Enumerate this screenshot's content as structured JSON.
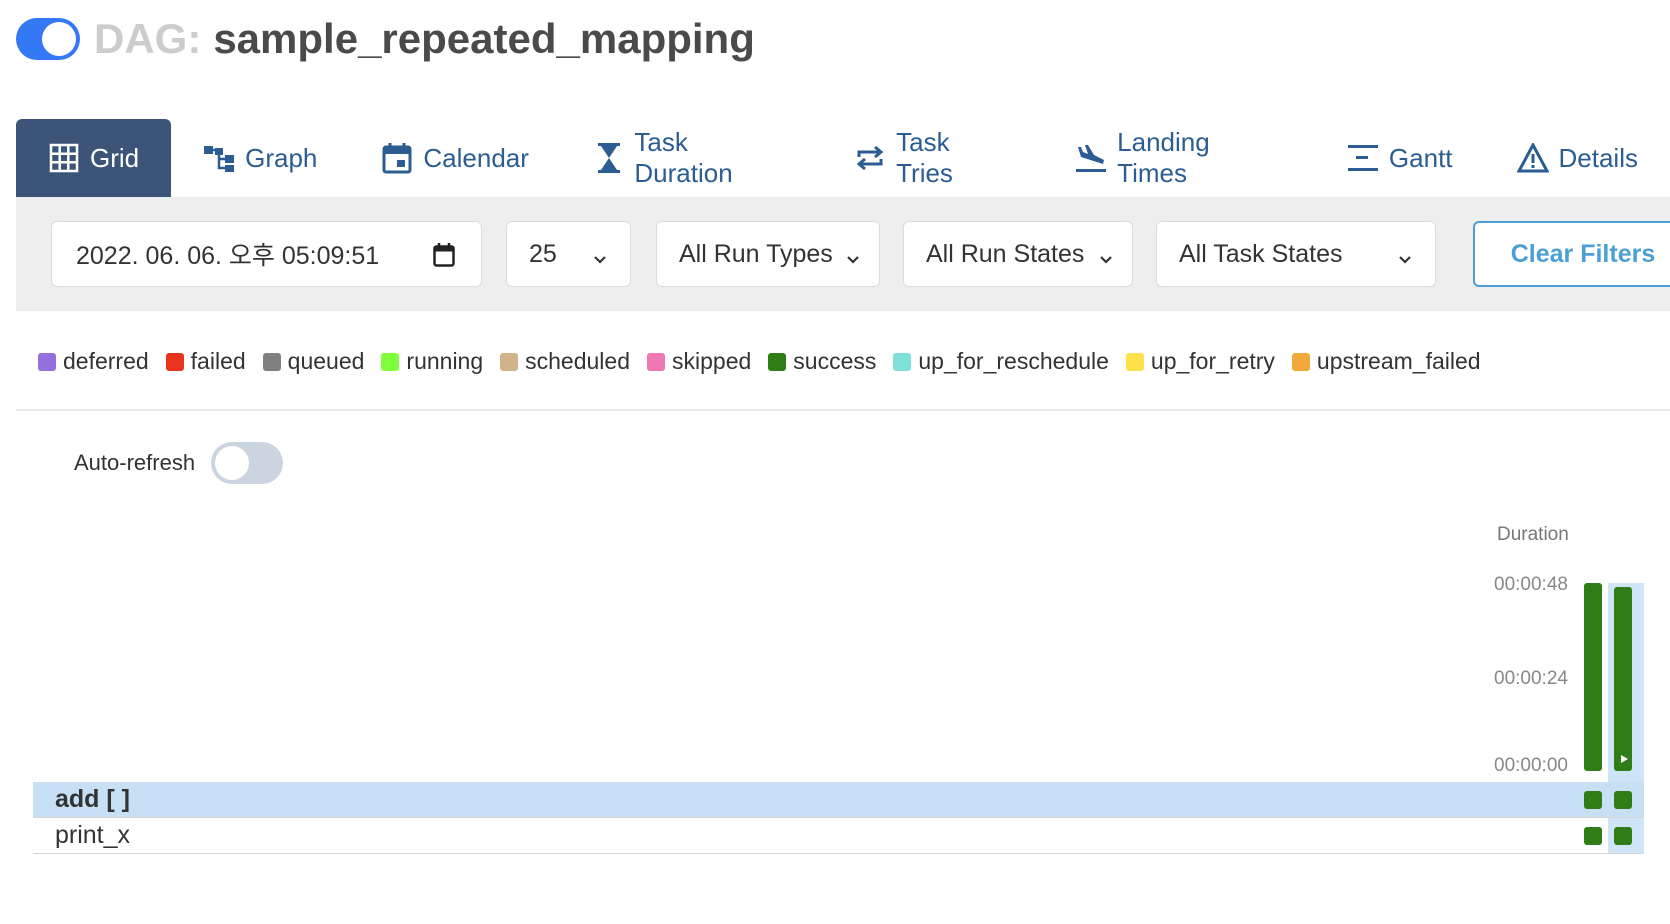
{
  "header": {
    "dag_prefix": "DAG:",
    "dag_name": "sample_repeated_mapping",
    "paused_toggle_on": true
  },
  "tabs": [
    {
      "label": "Grid",
      "icon": "grid-icon",
      "active": true
    },
    {
      "label": "Graph",
      "icon": "graph-icon"
    },
    {
      "label": "Calendar",
      "icon": "calendar-icon"
    },
    {
      "label": "Task Duration",
      "icon": "hourglass-icon"
    },
    {
      "label": "Task Tries",
      "icon": "repeat-icon"
    },
    {
      "label": "Landing Times",
      "icon": "plane-landing-icon"
    },
    {
      "label": "Gantt",
      "icon": "gantt-icon"
    },
    {
      "label": "Details",
      "icon": "warning-triangle-icon"
    }
  ],
  "filters": {
    "base_date": "2022. 06. 06. 오후 05:09:51",
    "num_runs": "25",
    "run_types": "All Run Types",
    "run_states": "All Run States",
    "task_states": "All Task States",
    "clear_label": "Clear Filters"
  },
  "legend": [
    {
      "label": "deferred",
      "color": "#9370db"
    },
    {
      "label": "failed",
      "color": "#e8331d"
    },
    {
      "label": "queued",
      "color": "#808080"
    },
    {
      "label": "running",
      "color": "#7fff3a"
    },
    {
      "label": "scheduled",
      "color": "#d2b48c"
    },
    {
      "label": "skipped",
      "color": "#ef77b4"
    },
    {
      "label": "success",
      "color": "#2f7d17"
    },
    {
      "label": "up_for_reschedule",
      "color": "#7ee0d8"
    },
    {
      "label": "up_for_retry",
      "color": "#ffe14c"
    },
    {
      "label": "upstream_failed",
      "color": "#f2a93b"
    }
  ],
  "auto_refresh": {
    "label": "Auto-refresh",
    "enabled": false
  },
  "grid": {
    "duration_label": "Duration",
    "ticks": [
      "00:00:48",
      "00:00:24",
      "00:00:00"
    ],
    "runs": [
      {
        "duration_fraction": 1.0,
        "state": "success"
      },
      {
        "duration_fraction": 0.98,
        "state": "success",
        "selected": true
      }
    ],
    "tasks": [
      {
        "label": "add [ ]",
        "selected": true
      },
      {
        "label": "print_x",
        "selected": false
      }
    ]
  }
}
